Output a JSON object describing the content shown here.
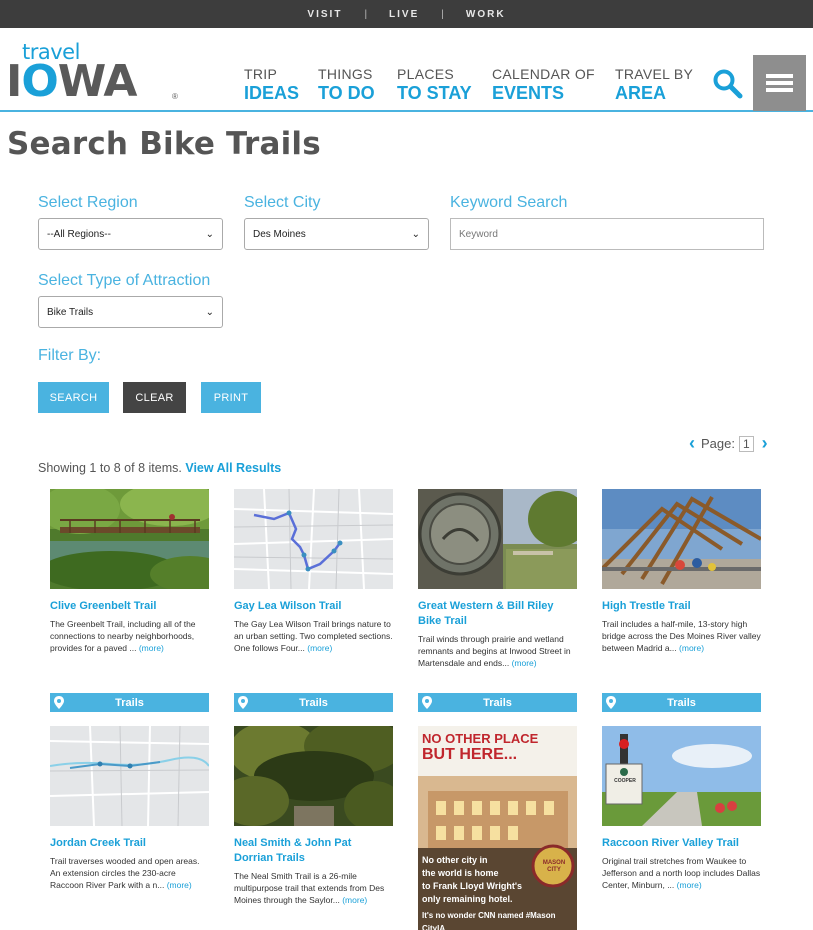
{
  "topbar": {
    "links": [
      "VISIT",
      "LIVE",
      "WORK"
    ],
    "separator": "|"
  },
  "logo": {
    "travel": "travel",
    "iowa_i": "I",
    "iowa_o": "O",
    "iowa_rest": "WA",
    "reg": "®"
  },
  "nav": [
    {
      "small": "TRIP",
      "big": "IDEAS"
    },
    {
      "small": "THINGS",
      "big": "TO DO"
    },
    {
      "small": "PLACES",
      "big": "TO STAY"
    },
    {
      "small": "CALENDAR OF",
      "big": "EVENTS"
    },
    {
      "small": "TRAVEL BY",
      "big": "AREA"
    }
  ],
  "page": {
    "title": "Search Bike Trails"
  },
  "filters": {
    "region_label": "Select Region",
    "region_value": "--All Regions--",
    "city_label": "Select City",
    "city_value": "Des Moines",
    "keyword_label": "Keyword Search",
    "keyword_placeholder": "Keyword",
    "type_label": "Select Type of Attraction",
    "type_value": "Bike Trails",
    "filter_by": "Filter By:"
  },
  "buttons": {
    "search": "SEARCH",
    "clear": "CLEAR",
    "print": "PRINT"
  },
  "pager": {
    "label": "Page:",
    "current": "1"
  },
  "results": {
    "showing": "Showing 1 to 8 of 8 items.",
    "view_all": "View All Results"
  },
  "cards": [
    {
      "title": "Clive Greenbelt Trail",
      "desc": "The Greenbelt Trail, including all of the connections to nearby neighborhoods, provides for a paved ...",
      "more": "(more)",
      "tag": "Trails"
    },
    {
      "title": "Gay Lea Wilson Trail",
      "desc": "The Gay Lea Wilson Trail brings nature to an urban setting. Two completed sections. One follows Four...",
      "more": "(more)",
      "tag": "Trails"
    },
    {
      "title": "Great Western & Bill Riley Bike Trail",
      "desc": "Trail winds through prairie and wetland remnants and begins at Inwood Street in Martensdale and ends...",
      "more": "(more)",
      "tag": "Trails"
    },
    {
      "title": "High Trestle Trail",
      "desc": "Trail includes a half-mile, 13-story high bridge across the Des Moines River valley between Madrid a...",
      "more": "(more)",
      "tag": "Trails"
    },
    {
      "title": "Jordan Creek Trail",
      "desc": "Trail traverses wooded and open areas. An extension circles the 230-acre Raccoon River Park with a n...",
      "more": "(more)"
    },
    {
      "title": "Neal Smith & John Pat Dorrian Trails",
      "desc": "The Neal Smith Trail is a 26-mile multipurpose trail that extends from Des Moines through the Saylor...",
      "more": "(more)"
    },
    {
      "title": "",
      "desc": "",
      "more": ""
    },
    {
      "title": "Raccoon River Valley Trail",
      "desc": "Original trail stretches from Waukee to Jefferson and a north loop includes Dallas Center, Minburn, ...",
      "more": "(more)"
    }
  ],
  "ad": {
    "headline1": "NO OTHER PLACE",
    "headline2": "BUT HERE...",
    "line1": "No other city in",
    "line2": "the world is home",
    "line3": "to Frank Lloyd Wright's",
    "line4": "only remaining hotel.",
    "line5": "It's no wonder CNN named #Mason CityIA",
    "badge": "MASON CITY"
  },
  "signpost": {
    "text": "COOPER"
  },
  "colors": {
    "accent": "#4ab3e0",
    "dark": "#3d3d3d",
    "clear_btn": "#444444",
    "menu_btn": "#8e8e8e"
  }
}
